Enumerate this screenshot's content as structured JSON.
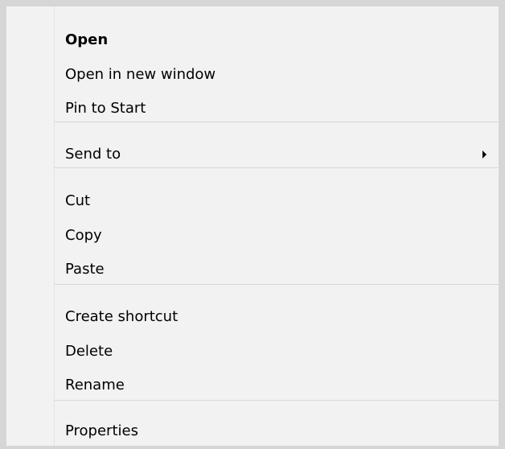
{
  "context_menu": {
    "groups": [
      {
        "items": [
          {
            "label": "Open",
            "bold": true
          },
          {
            "label": "Open in new window"
          },
          {
            "label": "Pin to Start"
          }
        ]
      },
      {
        "items": [
          {
            "label": "Send to",
            "submenu": true,
            "submenu_icon": "chevron-right-icon"
          }
        ]
      },
      {
        "items": [
          {
            "label": "Cut"
          },
          {
            "label": "Copy"
          },
          {
            "label": "Paste"
          }
        ]
      },
      {
        "items": [
          {
            "label": "Create shortcut"
          },
          {
            "label": "Delete"
          },
          {
            "label": "Rename"
          }
        ]
      },
      {
        "items": [
          {
            "label": "Properties"
          }
        ]
      }
    ],
    "colors": {
      "background": "#f2f2f2",
      "border": "#d6d6d6",
      "separator": "#d7d7d7",
      "text": "#000000"
    }
  }
}
